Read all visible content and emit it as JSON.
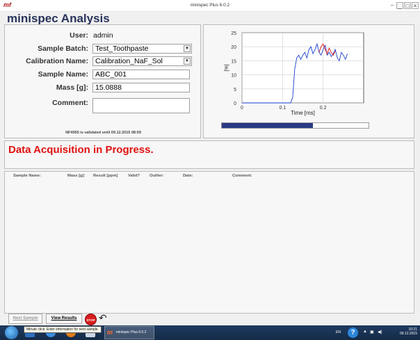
{
  "window": {
    "title": "minispec Plus 6.0.2",
    "logo": "mf"
  },
  "app_title": "minispec Analysis",
  "form": {
    "user_label": "User:",
    "user_value": "admin",
    "sample_batch_label": "Sample Batch:",
    "sample_batch_value": "Test_Toothpaste",
    "calibration_label": "Calibration Name:",
    "calibration_value": "Calibration_NaF_Sol",
    "sample_name_label": "Sample Name:",
    "sample_name_value": "ABC_001",
    "mass_label": "Mass [g]:",
    "mass_value": "15.0888",
    "comment_label": "Comment:",
    "comment_value": "",
    "validated_text": "NF4055 is validated until 09.12.2015 08:59"
  },
  "chart_data": {
    "type": "line",
    "xlabel": "Time [ms]",
    "ylabel": "[%]",
    "xlim": [
      0,
      0.3
    ],
    "ylim": [
      0,
      25
    ],
    "x_ticks": [
      "0",
      "0.1",
      "0.2"
    ],
    "y_ticks": [
      "0",
      "5",
      "10",
      "15",
      "20",
      "25"
    ],
    "grid": true,
    "series": [
      {
        "color": "#1a3fd0",
        "x": [
          0.0,
          0.12,
          0.125,
          0.13,
          0.135,
          0.14,
          0.145,
          0.15,
          0.155,
          0.16,
          0.165,
          0.17,
          0.175,
          0.18,
          0.185,
          0.19,
          0.195,
          0.2,
          0.205,
          0.21,
          0.215,
          0.22,
          0.225,
          0.23,
          0.235,
          0.24,
          0.245,
          0.25,
          0.255,
          0.26
        ],
        "y": [
          0,
          0,
          2,
          12,
          16,
          17,
          15.5,
          17,
          18,
          16,
          19,
          20,
          17.5,
          19,
          21,
          18,
          17,
          19,
          20.5,
          17,
          18,
          16.5,
          17.5,
          19,
          16,
          15,
          18,
          17,
          15.5,
          17.5
        ]
      },
      {
        "color": "#e01010",
        "x": [
          0.19,
          0.195,
          0.2,
          0.205,
          0.21,
          0.215,
          0.22,
          0.225,
          0.23
        ],
        "y": [
          18,
          20,
          21,
          19,
          17.5,
          19.5,
          18,
          17,
          18.5
        ]
      }
    ]
  },
  "progress": {
    "value": 0.62,
    "fill_color": "#2a3a86"
  },
  "status": {
    "text": "Data Acquisition in Progress.",
    "color": "#e01010"
  },
  "results": {
    "columns": [
      "Sample Name:",
      "Mass [g]:",
      "Result [ppm]",
      "Valid?",
      "Outlier:",
      "Date:",
      "Comment:"
    ]
  },
  "buttons": {
    "next_sample": "Next Sample",
    "view_results": "View Results",
    "stop": "STOP"
  },
  "taskbar": {
    "tooltip": "Minute click: Enter information for next sample.",
    "app_label": "minispec Plus 6.0.2",
    "lang": "EN",
    "time": "10:21",
    "date": "09.12.2015"
  }
}
